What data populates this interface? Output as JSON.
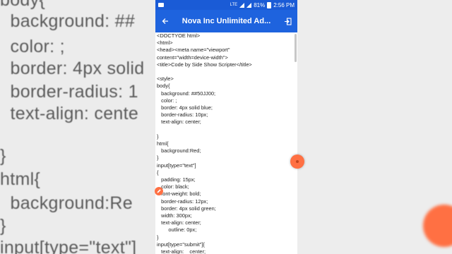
{
  "background": {
    "lines": [
      "body{",
      "  background: ##",
      "  color: ;",
      "  border: 4px solid",
      "  border-radius: 1",
      "  text-align: cente",
      "",
      "}",
      "html{",
      "  background:Re",
      "}",
      "input[type=\"text\"]"
    ]
  },
  "status_bar": {
    "signal_label": "LTE",
    "battery": "81%",
    "time": "2:56 PM"
  },
  "app_bar": {
    "title": "Nova Inc Unlimited Ad..."
  },
  "code_text": "<DOCTYOE html>\n<html>\n<head><meta name=\"viewport\"\ncontent=\"width=device-width\">\n<title>Code by Side Show Scripter</title>\n\n<style>\nbody{\n   background: ##50JJ00;\n   color: ;\n   border: 4px solid blue;\n   border-radius: 10px;\n   text-align: center;\n\n}\nhtml{\n   background:Red;\n}\ninput[type=\"text\"]\n{\n   padding: 15px;\n   color: black;\n   font-weight: bold;\n   border-radius: 12px;\n   border: 4px solid green;\n   width: 300px;\n   text-align: center;\n        outline: 0px;\n}\ninput[type=\"submit\"]{\n   text-align:    center;",
  "colors": {
    "status_bar": "#1a5bd6",
    "app_bar": "#1e63de",
    "fab": "#ff7043"
  },
  "icons": {
    "back": "arrow-left-icon",
    "exit": "exit-icon",
    "edit": "pencil-icon",
    "fab": "circle-fab-icon"
  }
}
